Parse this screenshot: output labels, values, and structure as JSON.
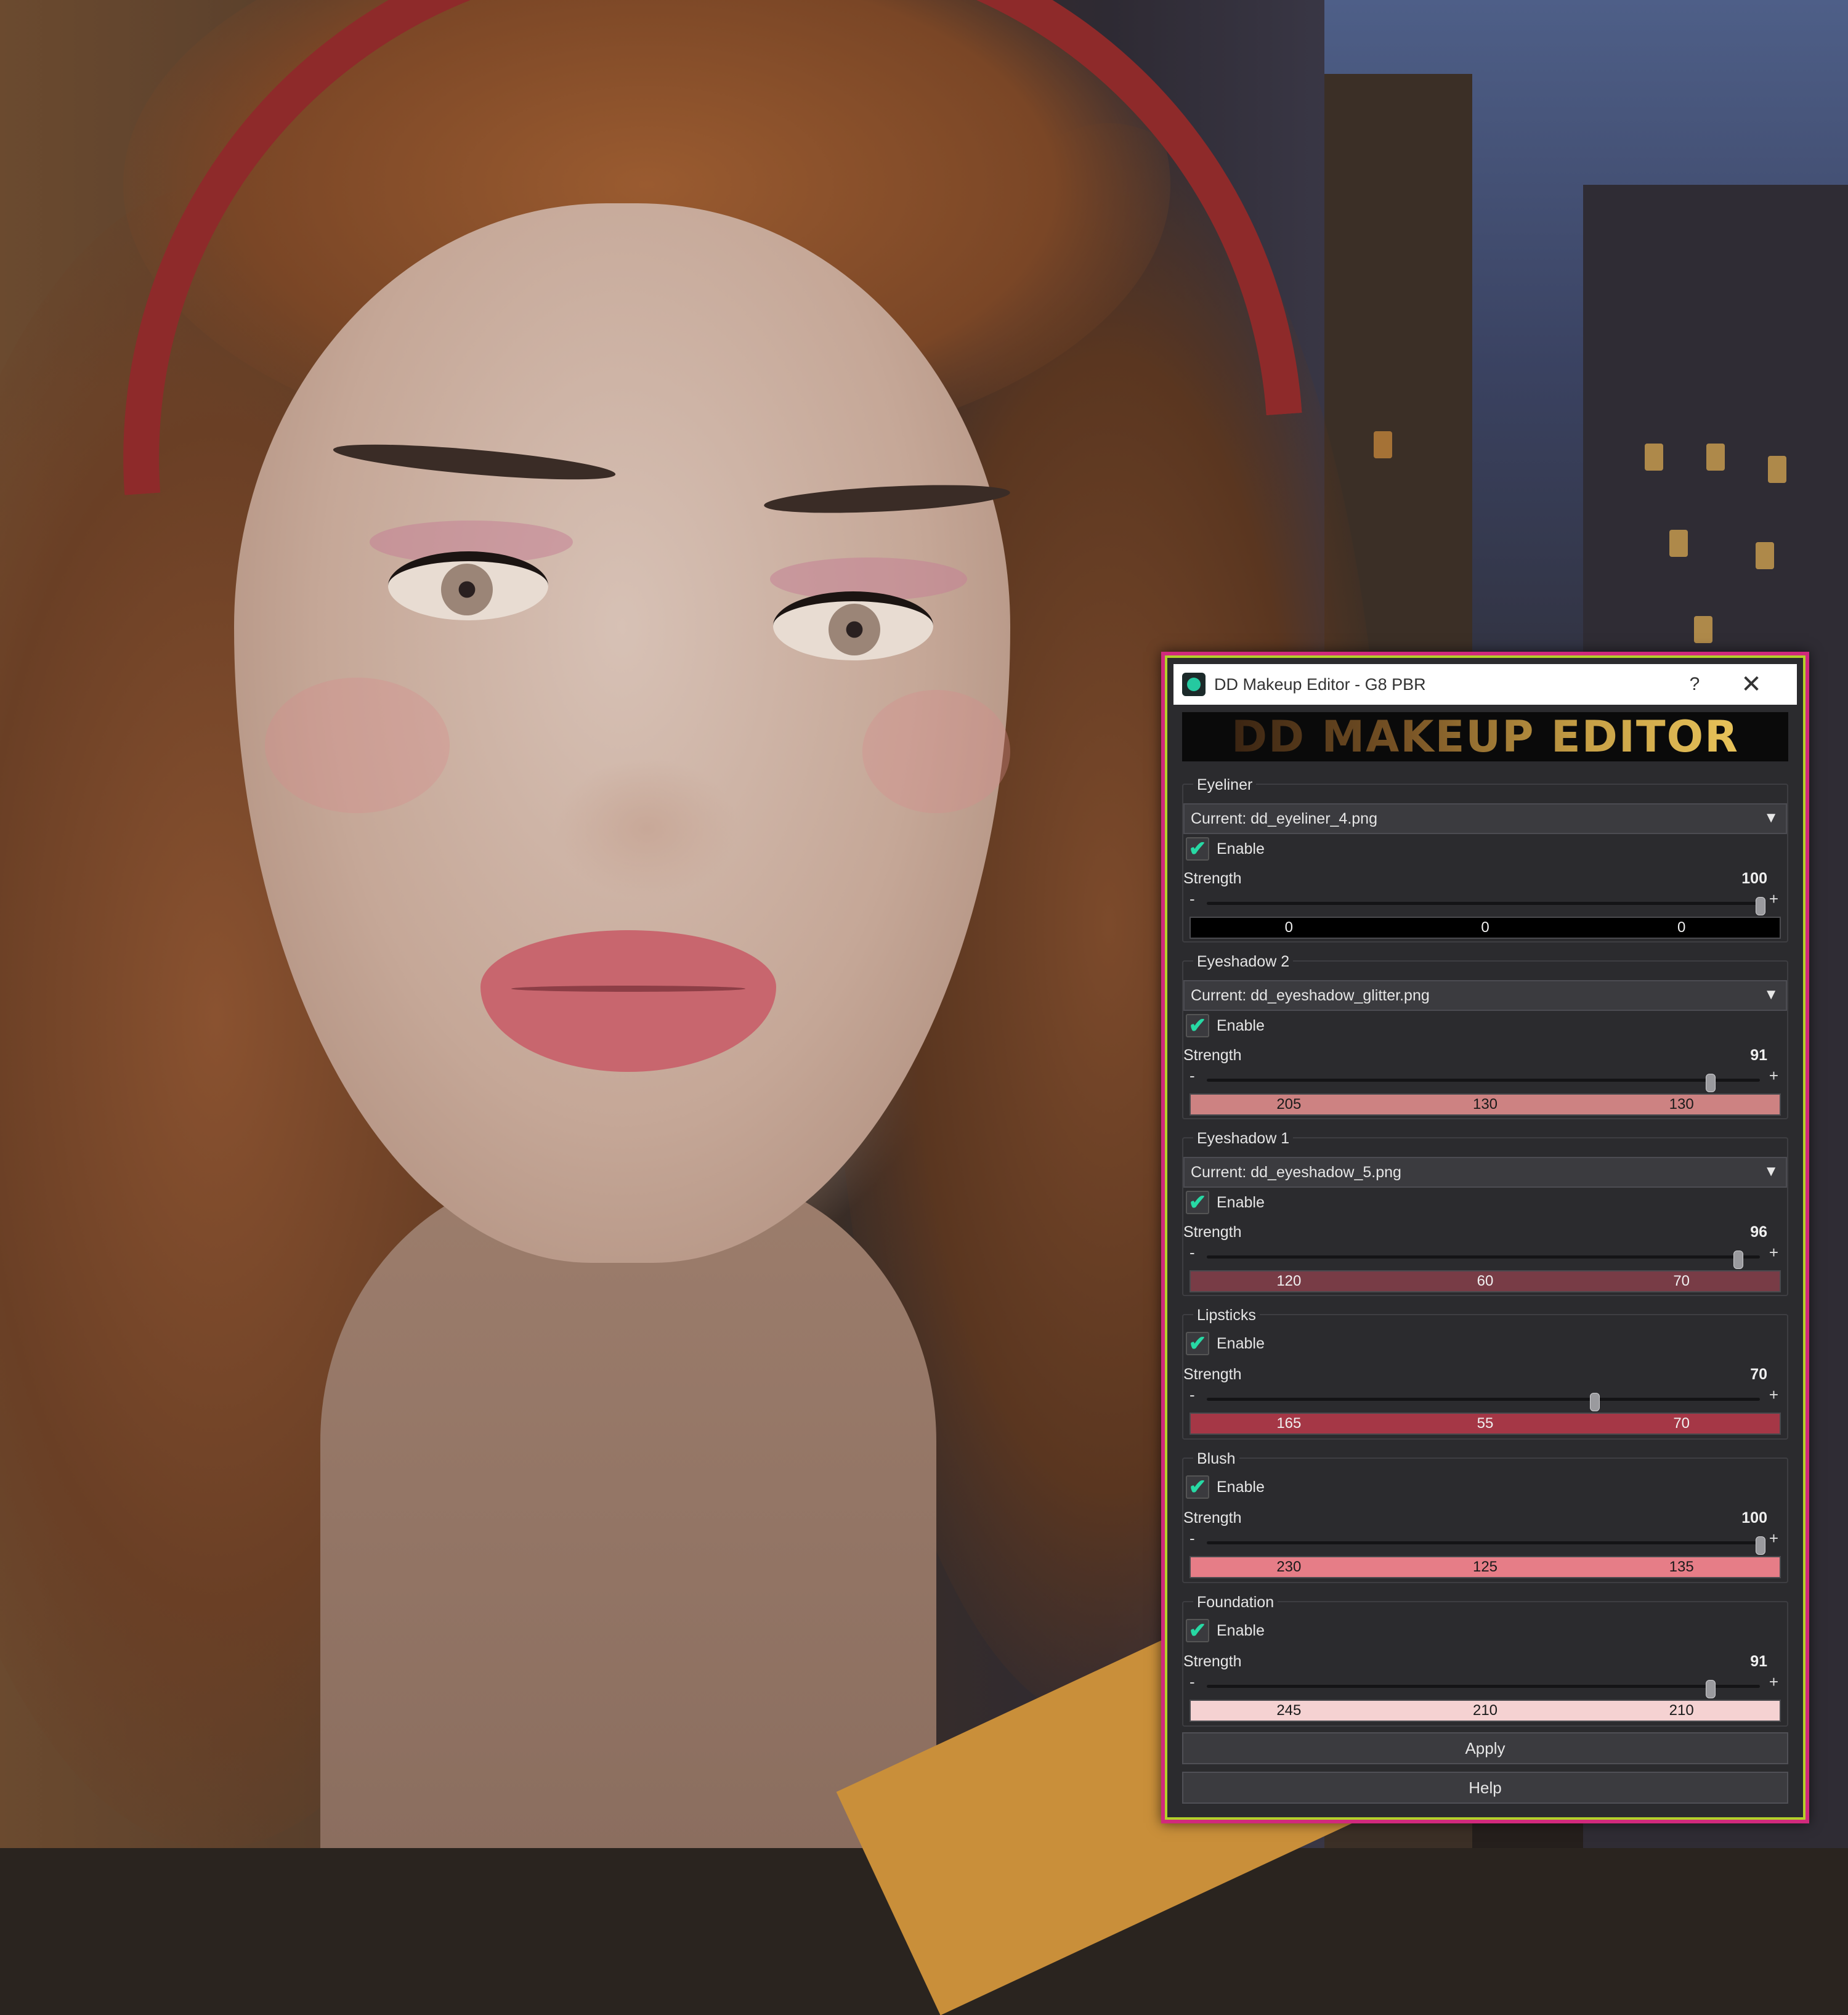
{
  "dialog": {
    "title": "DD Makeup Editor - G8 PBR",
    "help_glyph": "?",
    "close_glyph": "✕",
    "banner_text": "DD MAKEUP EDITOR",
    "app_icon": "dd-logo-icon"
  },
  "sections": [
    {
      "label": "Eyeliner",
      "current": "Current: dd_eyeliner_4.png",
      "enable": "Enable",
      "enabled": true,
      "strength_label": "Strength",
      "strength": "100",
      "strength_value": 100,
      "rgb": [
        "0",
        "0",
        "0"
      ],
      "color": "#000000"
    },
    {
      "label": "Eyeshadow 2",
      "current": "Current: dd_eyeshadow_glitter.png",
      "enable": "Enable",
      "enabled": true,
      "strength_label": "Strength",
      "strength": "91",
      "strength_value": 91,
      "rgb": [
        "205",
        "130",
        "130"
      ],
      "color": "#cd8282"
    },
    {
      "label": "Eyeshadow 1",
      "current": "Current: dd_eyeshadow_5.png",
      "enable": "Enable",
      "enabled": true,
      "strength_label": "Strength",
      "strength": "96",
      "strength_value": 96,
      "rgb": [
        "120",
        "60",
        "70"
      ],
      "color": "#783c46"
    },
    {
      "label": "Lipsticks",
      "enable": "Enable",
      "enabled": true,
      "strength_label": "Strength",
      "strength": "70",
      "strength_value": 70,
      "rgb": [
        "165",
        "55",
        "70"
      ],
      "color": "#a53746"
    },
    {
      "label": "Blush",
      "enable": "Enable",
      "enabled": true,
      "strength_label": "Strength",
      "strength": "100",
      "strength_value": 100,
      "rgb": [
        "230",
        "125",
        "135"
      ],
      "color": "#e67d87"
    },
    {
      "label": "Foundation",
      "enable": "Enable",
      "enabled": true,
      "strength_label": "Strength",
      "strength": "91",
      "strength_value": 91,
      "rgb": [
        "245",
        "210",
        "210"
      ],
      "color": "#f5d2d2"
    }
  ],
  "buttons": {
    "apply": "Apply",
    "help": "Help"
  },
  "icons": {
    "check": "✔",
    "dropdown": "▼",
    "minus": "-",
    "plus": "+"
  }
}
